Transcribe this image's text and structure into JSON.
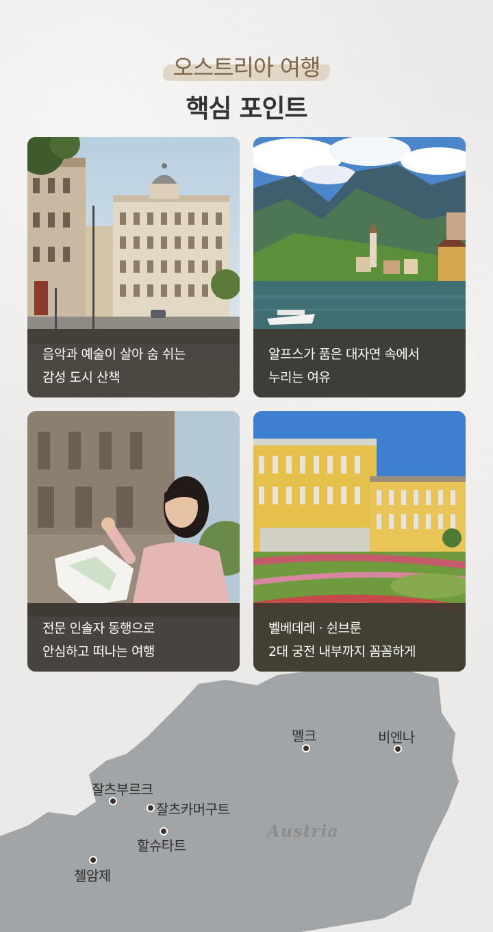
{
  "header": {
    "subtitle": "오스트리아 여행",
    "title": "핵심 포인트"
  },
  "cards": [
    {
      "line1": "음악과 예술이 살아 숨 쉬는",
      "line2": "감성 도시 산책",
      "image": "vienna-street-photo"
    },
    {
      "line1": "알프스가 품은 대자연 속에서",
      "line2": "누리는 여유",
      "image": "hallstatt-lake-photo"
    },
    {
      "line1": "전문 인솔자 동행으로",
      "line2": "안심하고 떠나는 여행",
      "image": "traveler-woman-map-photo"
    },
    {
      "line1": "벨베데레 · 쉰브룬",
      "line2": "2대 궁전 내부까지 꼼꼼하게",
      "image": "schonbrunn-palace-photo"
    }
  ],
  "map": {
    "country": "Austria",
    "cities": [
      "멜크",
      "비엔나",
      "잘츠부르크",
      "잘츠카머구트",
      "할슈타트",
      "첼암제"
    ]
  },
  "colors": {
    "background": "#ecebe9",
    "subtitle": "#7d6646",
    "title": "#333333",
    "caption_bg": "#3e3832",
    "map": "#a2a5a8"
  }
}
